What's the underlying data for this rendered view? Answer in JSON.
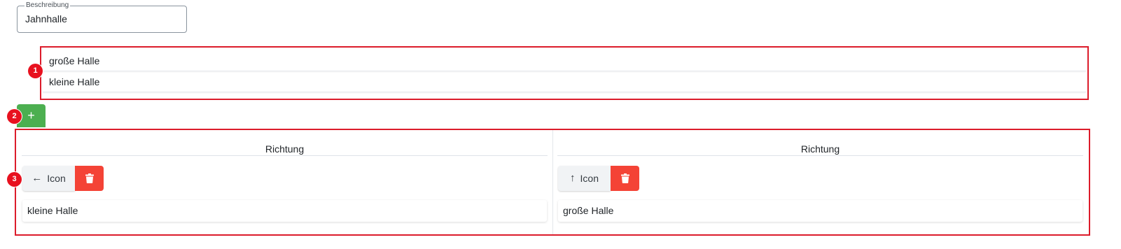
{
  "description": {
    "legend": "Beschreibung",
    "value": "Jahnhalle"
  },
  "halls": {
    "items": [
      "große Halle",
      "kleine Halle"
    ]
  },
  "add_button": {
    "icon": "plus-icon",
    "label": "+"
  },
  "markers": [
    "1",
    "2",
    "3"
  ],
  "columns": [
    {
      "title": "Richtung",
      "arrow": "←",
      "arrow_icon": "arrow-left-icon",
      "icon_label": "Icon",
      "target": "kleine Halle"
    },
    {
      "title": "Richtung",
      "arrow": "↑",
      "arrow_icon": "arrow-up-icon",
      "icon_label": "Icon",
      "target": "große Halle"
    }
  ],
  "colors": {
    "highlight": "#dc1c2b",
    "marker": "#e8111f",
    "add": "#4caf50",
    "delete": "#f44336"
  }
}
